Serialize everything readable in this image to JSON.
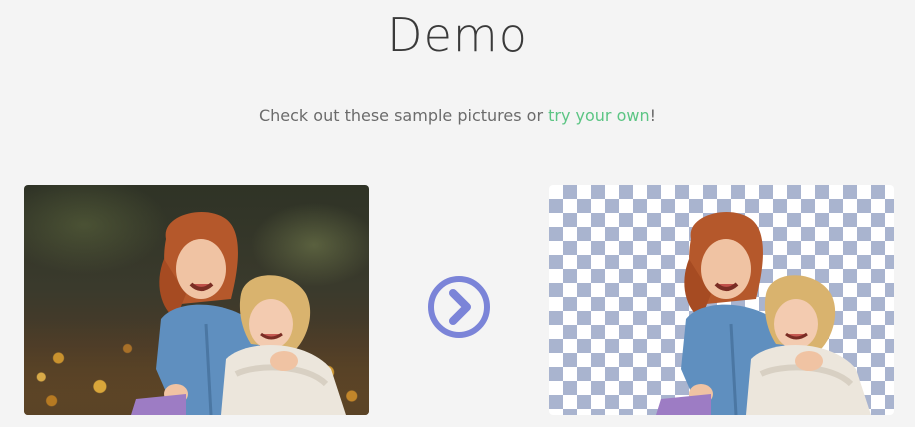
{
  "header": {
    "title": "Demo",
    "subtitle_prefix": "Check out these sample pictures or ",
    "subtitle_link": "try your own",
    "subtitle_suffix": "!"
  },
  "colors": {
    "link": "#5cc584",
    "arrow": "#7b84d8",
    "checker": "#a9b4cf",
    "background": "#f4f4f4"
  },
  "icons": {
    "arrow": "chevron-right-circle-icon"
  }
}
